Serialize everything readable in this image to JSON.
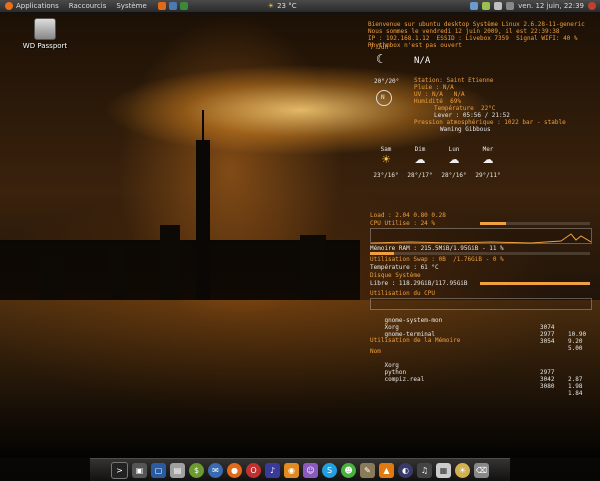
{
  "top_panel": {
    "menus": [
      "Applications",
      "Raccourcis",
      "Système"
    ],
    "weather_temp": "23 °C",
    "clock": "ven. 12 juin, 22:39",
    "colors": {
      "panel": "#3a3a3a",
      "accent": "#e8701a"
    }
  },
  "desktop_icons": [
    {
      "label": "WD Passport",
      "icon": "drive-icon"
    }
  ],
  "conky": {
    "header_lines": [
      "Bienvenue sur ubuntu desktop Système Linux 2.6.28-11-generic",
      "Nous sommes le vendredi 12 juin 2009, il est 22:39:38",
      "IP : 192.168.1.12  ESSID : Livebox 7359  Signal WIFI: 40 %",
      "Rhythmbox n'est pas ouvert"
    ],
    "weather": {
      "title": "N/A",
      "lines": [
        "Station: Saint Etienne",
        "Pluie : N/A",
        "UV : N/A   N/A",
        "Humidité  69%",
        "Température  22°C",
        "Lever : 05:56 / 21:52",
        "Pression atmosphérique : 1022 bar - stable",
        "Waning Gibbous"
      ],
      "side_labels": [
        "7 Jun",
        "20°/20°",
        "N"
      ],
      "forecast": [
        {
          "day": "Sam",
          "range": "23°/16°"
        },
        {
          "day": "Dim",
          "range": "28°/17°"
        },
        {
          "day": "Lun",
          "range": "28°/16°"
        },
        {
          "day": "Mer",
          "range": "29°/11°"
        }
      ]
    },
    "system": {
      "load": "Load : 2.04 0.80 0.28",
      "cpu": "CPU Utilise : 24 %",
      "memory": "Mémoire RAM : 215.5MiB/1.95GiB - 11 %",
      "swap": "Utilisation Swap : 0B  /1.76GiB - 0 %",
      "temp": "Température : 61 °C",
      "disk_title": "Disque Système",
      "disk": "Libre : 118.29GiB/117.95GiB",
      "cpu_title": "Utilisation du CPU",
      "processes_cpu": [
        {
          "name": "gnome-system-mon",
          "pid": "3074",
          "val": "10.90"
        },
        {
          "name": "Xorg",
          "pid": "2977",
          "val": "9.20"
        },
        {
          "name": "gnome-terminal",
          "pid": "3054",
          "val": "5.00"
        }
      ],
      "mem_title": "Utilisation de la Mémoire",
      "processes_mem_header": "Nom",
      "processes_mem": [
        {
          "name": "Xorg",
          "pid": "2977",
          "val": "2.87"
        },
        {
          "name": "python",
          "pid": "3042",
          "val": "1.98"
        },
        {
          "name": "compiz.real",
          "pid": "3080",
          "val": "1.84"
        }
      ],
      "cpu_percent": 24,
      "ram_percent": 11,
      "swap_percent": 0
    }
  },
  "dock": {
    "items": [
      "terminal-icon",
      "monitor-icon",
      "virtualbox-icon",
      "files-icon",
      "pidgin-icon",
      "thunderbird-icon",
      "firefox-icon",
      "opera-icon",
      "music-icon",
      "rss-icon",
      "pidgin2-icon",
      "skype-icon",
      "chat-icon",
      "gimp-icon",
      "vlc-icon",
      "eclipse-icon",
      "volume-icon",
      "calendar-icon",
      "weather-icon",
      "trash-icon"
    ]
  }
}
